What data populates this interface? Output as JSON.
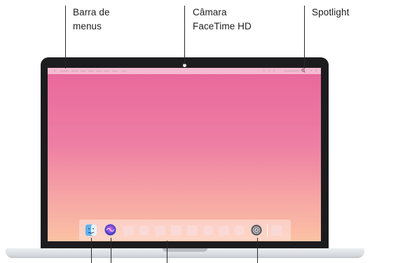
{
  "callouts": {
    "menu_bar": "Barra de\nmenus",
    "camera": "Câmara\nFaceTime HD",
    "spotlight": "Spotlight"
  },
  "colors": {
    "screen_top": "#e8679b",
    "screen_bottom": "#fbc2a3",
    "bezel": "#1c1c1e",
    "leader": "#2a2a2a"
  },
  "icons": {
    "finder": "finder-icon",
    "siri": "siri-icon",
    "system_preferences": "gear-icon",
    "spotlight": "search-icon"
  }
}
